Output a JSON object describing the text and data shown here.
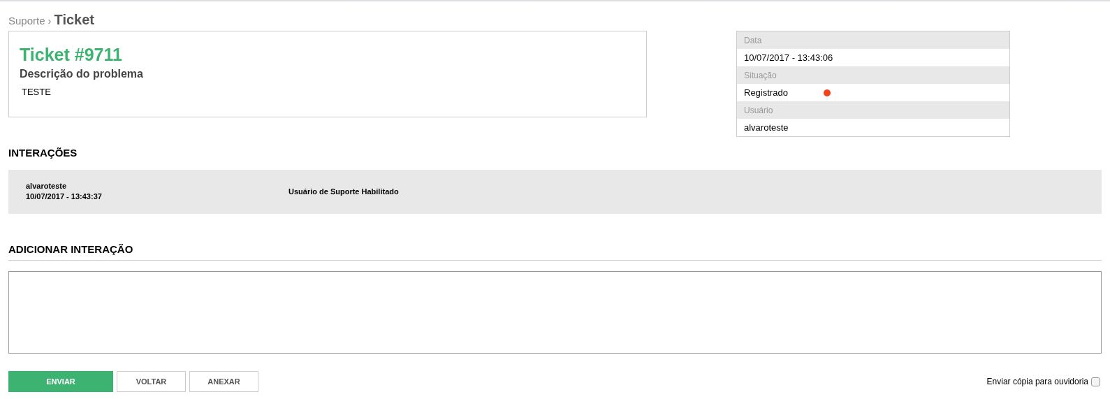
{
  "breadcrumb": {
    "parent": "Suporte",
    "separator": "›",
    "current": "Ticket"
  },
  "ticket": {
    "title": "Ticket #9711",
    "description_label": "Descrição do problema",
    "description": "TESTE"
  },
  "info": [
    {
      "label": "Data",
      "value": "10/07/2017 - 13:43:06"
    },
    {
      "label": "Situação",
      "value": "Registrado",
      "color": "#f4411e"
    },
    {
      "label": "Usuário",
      "value": "alvaroteste"
    }
  ],
  "interactions": {
    "heading": "INTERAÇÕES",
    "items": [
      {
        "user": "alvaroteste",
        "date": "10/07/2017 - 13:43:37",
        "message": "Usuário de Suporte Habilitado"
      }
    ]
  },
  "add_interaction": {
    "heading": "ADICIONAR INTERAÇÃO"
  },
  "buttons": [
    {
      "label": "ENVIAR",
      "kind": "primary"
    },
    {
      "label": "VOLTAR",
      "kind": "secondary"
    },
    {
      "label": "ANEXAR",
      "kind": "secondary"
    }
  ],
  "ombudsman_copy": {
    "label": "Enviar cópia para ouvidoria",
    "checked": false
  }
}
